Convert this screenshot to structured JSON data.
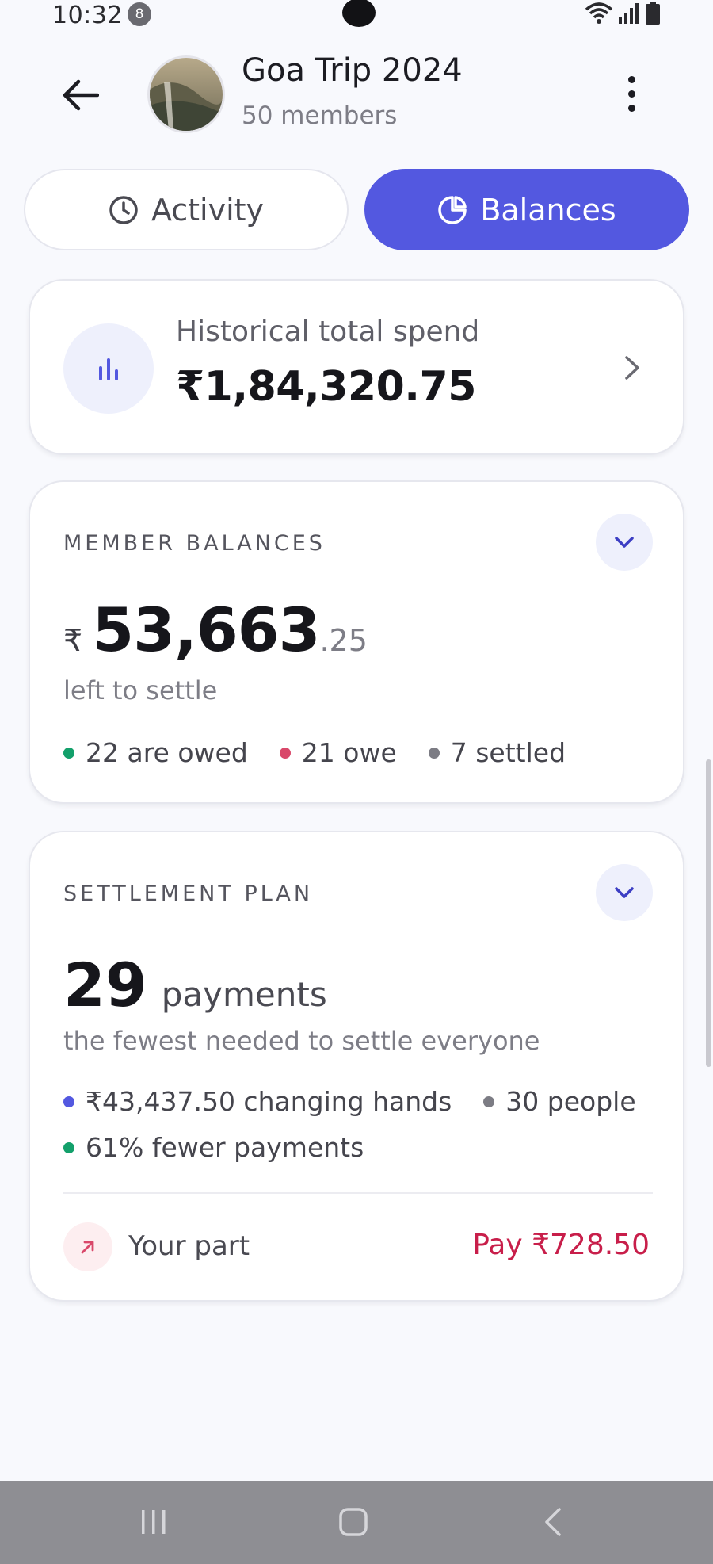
{
  "status_bar": {
    "time": "10:32",
    "notification_count": "8",
    "icons": [
      "wifi-icon",
      "signal-icon",
      "battery-icon"
    ]
  },
  "header": {
    "title": "Goa Trip 2024",
    "subtitle": "50 members",
    "back_icon": "arrow-left-icon",
    "more_icon": "more-vertical-icon"
  },
  "tabs": [
    {
      "label": "Activity",
      "icon": "clock-icon",
      "selected": false
    },
    {
      "label": "Balances",
      "icon": "pie-chart-icon",
      "selected": true
    }
  ],
  "spend_card": {
    "label": "Historical total spend",
    "value": "₹1,84,320.75",
    "icon": "bar-chart-icon"
  },
  "member_balances": {
    "title": "MEMBER BALANCES",
    "currency": "₹",
    "amount_main": "53,663",
    "amount_decimal": ".25",
    "caption": "left to settle",
    "legend": [
      {
        "label": "22 are owed",
        "color": "#13a06b"
      },
      {
        "label": "21 owe",
        "color": "#d9486a"
      },
      {
        "label": "7 settled",
        "color": "#7c7c84"
      }
    ]
  },
  "settlement_plan": {
    "title": "SETTLEMENT PLAN",
    "count": "29",
    "count_word": "payments",
    "caption": "the fewest needed to settle everyone",
    "stats": [
      {
        "label": "₹43,437.50 changing hands",
        "color": "#5358e0"
      },
      {
        "label": "30 people",
        "color": "#7c7c84"
      },
      {
        "label": "61% fewer payments",
        "color": "#13a06b"
      }
    ],
    "your_part_label": "Your part",
    "your_part_amount": "Pay ₹728.50"
  },
  "colors": {
    "accent": "#5358e0",
    "negative": "#c81e4a",
    "positive": "#13a06b"
  }
}
